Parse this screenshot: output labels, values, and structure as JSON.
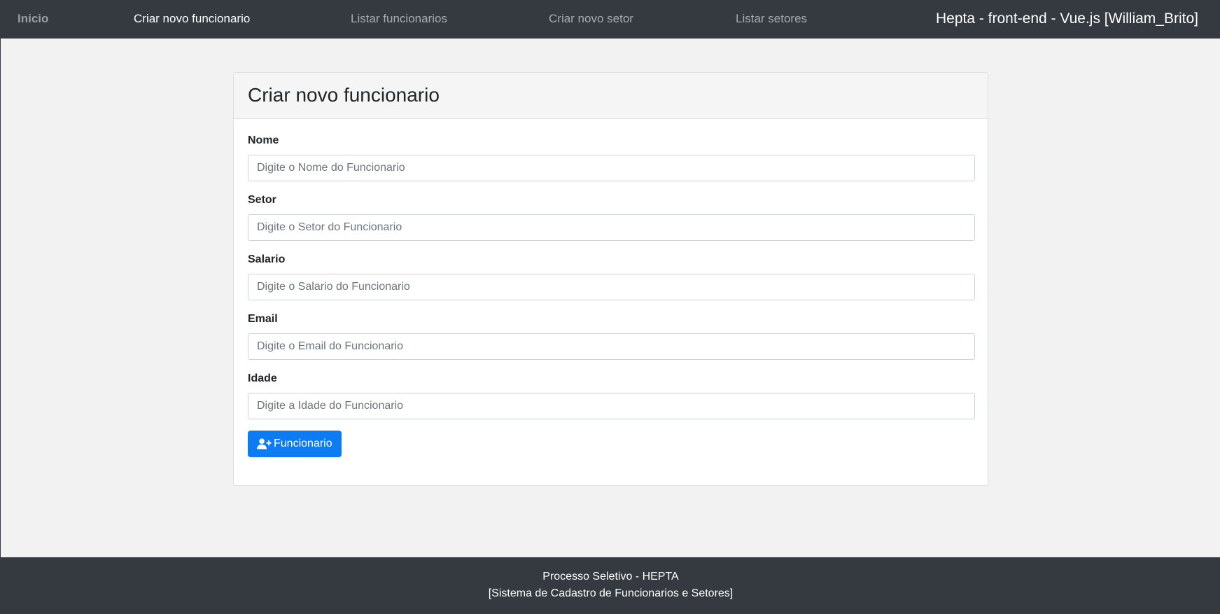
{
  "navbar": {
    "home": "Inicio",
    "items": [
      {
        "label": "Criar novo funcionario",
        "active": true
      },
      {
        "label": "Listar funcionarios",
        "active": false
      },
      {
        "label": "Criar novo setor",
        "active": false
      },
      {
        "label": "Listar setores",
        "active": false
      }
    ],
    "title": "Hepta - front-end - Vue.js [William_Brito]"
  },
  "card": {
    "title": "Criar novo funcionario",
    "fields": [
      {
        "label": "Nome",
        "placeholder": "Digite o Nome do Funcionario",
        "value": ""
      },
      {
        "label": "Setor",
        "placeholder": "Digite o Setor do Funcionario",
        "value": ""
      },
      {
        "label": "Salario",
        "placeholder": "Digite o Salario do Funcionario",
        "value": ""
      },
      {
        "label": "Email",
        "placeholder": "Digite o Email do Funcionario",
        "value": ""
      },
      {
        "label": "Idade",
        "placeholder": "Digite a Idade do Funcionario",
        "value": ""
      }
    ],
    "submit": {
      "label": "Funcionario",
      "icon": "user-plus-icon"
    }
  },
  "footer": {
    "line1": "Processo Seletivo - HEPTA",
    "line2": "[Sistema de Cadastro de Funcionarios e Setores]"
  },
  "colors": {
    "navbar_bg": "#343a40",
    "page_bg": "#f2f2f2",
    "primary": "#0d7cf2"
  }
}
